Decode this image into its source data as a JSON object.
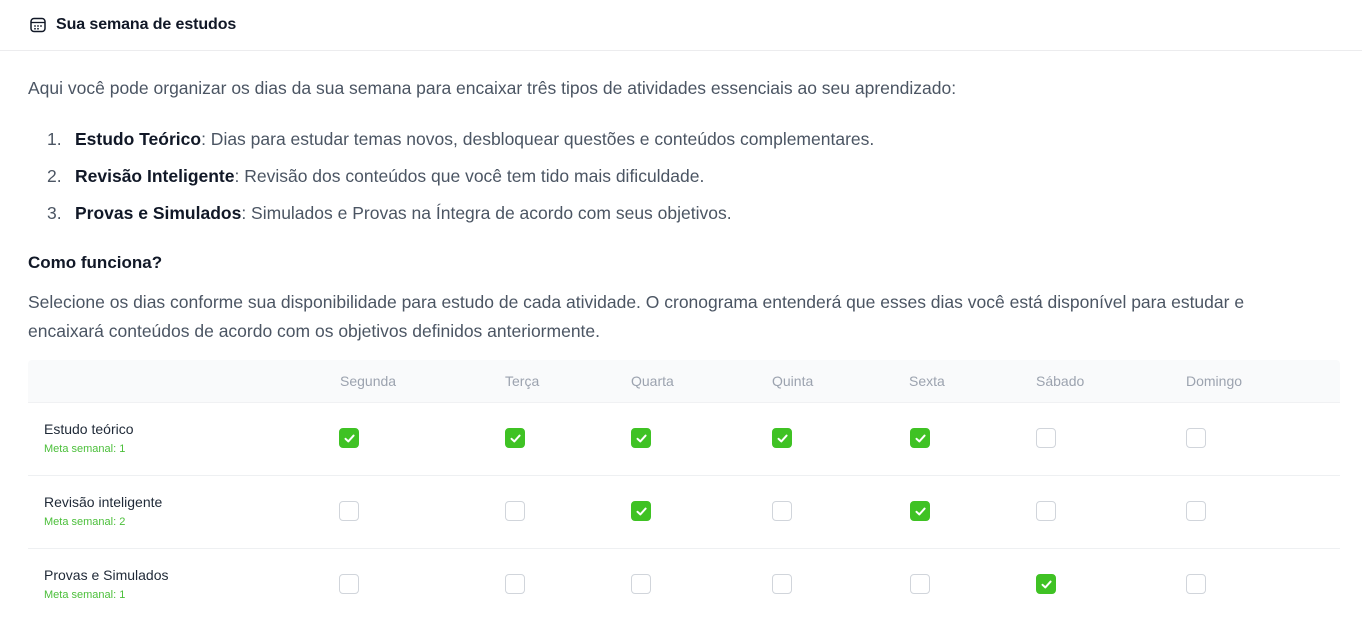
{
  "header": {
    "title": "Sua semana de estudos",
    "icon": "calendar-icon"
  },
  "intro": "Aqui você pode organizar os dias da sua semana para encaixar três tipos de atividades essenciais ao seu aprendizado:",
  "activity_types": [
    {
      "num": "1.",
      "title": "Estudo Teórico",
      "desc": ": Dias para estudar temas novos, desbloquear questões e conteúdos complementares."
    },
    {
      "num": "2.",
      "title": "Revisão Inteligente",
      "desc": ": Revisão dos conteúdos que você tem tido mais dificuldade."
    },
    {
      "num": "3.",
      "title": "Provas e Simulados",
      "desc": ": Simulados e Provas na Íntegra de acordo com seus objetivos."
    }
  ],
  "how": {
    "title": "Como funciona?",
    "text": "Selecione os dias conforme sua disponibilidade para estudo de cada atividade. O cronograma entenderá que esses dias você está disponível para estudar e encaixará conteúdos de acordo com os objetivos definidos anteriormente."
  },
  "schedule": {
    "days": [
      "Segunda",
      "Terça",
      "Quarta",
      "Quinta",
      "Sexta",
      "Sábado",
      "Domingo"
    ],
    "rows": [
      {
        "name": "Estudo teórico",
        "meta": "Meta semanal: 1",
        "checked": [
          true,
          true,
          true,
          true,
          true,
          false,
          false
        ]
      },
      {
        "name": "Revisão inteligente",
        "meta": "Meta semanal: 2",
        "checked": [
          false,
          false,
          true,
          false,
          true,
          false,
          false
        ]
      },
      {
        "name": "Provas e Simulados",
        "meta": "Meta semanal: 1",
        "checked": [
          false,
          false,
          false,
          false,
          false,
          true,
          false
        ]
      }
    ],
    "colors": {
      "checked": "#3fc224",
      "meta": "#4bbf3a"
    }
  }
}
